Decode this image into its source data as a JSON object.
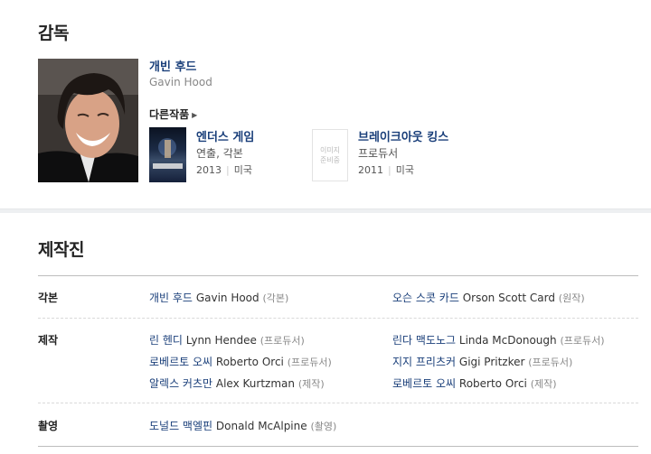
{
  "director": {
    "section_title": "감독",
    "name_ko": "개빈 후드",
    "name_en": "Gavin Hood",
    "other_works_label": "다른작품",
    "films": [
      {
        "title": "엔더스 게임",
        "role": "연출, 각본",
        "year": "2013",
        "country": "미국",
        "poster_title": "엔더스 게임"
      },
      {
        "title": "브레이크아웃 킹스",
        "role": "프로듀서",
        "year": "2011",
        "country": "미국",
        "placeholder": "이미지 준비중"
      }
    ]
  },
  "crew": {
    "section_title": "제작진",
    "rows": [
      {
        "label": "각본",
        "credits": [
          {
            "ko": "개빈 후드",
            "en": "Gavin Hood",
            "role": "(각본)"
          },
          {
            "ko": "오슨 스콧 카드",
            "en": "Orson Scott Card",
            "role": "(원작)"
          }
        ]
      },
      {
        "label": "제작",
        "credits": [
          {
            "ko": "린 헨디",
            "en": "Lynn Hendee",
            "role": "(프로듀서)"
          },
          {
            "ko": "린다 맥도노그",
            "en": "Linda McDonough",
            "role": "(프로듀서)"
          },
          {
            "ko": "로베르토 오씨",
            "en": "Roberto Orci",
            "role": "(프로듀서)"
          },
          {
            "ko": "지지 프리츠커",
            "en": "Gigi Pritzker",
            "role": "(프로듀서)"
          },
          {
            "ko": "알렉스 커츠만",
            "en": "Alex Kurtzman",
            "role": "(제작)"
          },
          {
            "ko": "로베르토 오씨",
            "en": "Roberto Orci",
            "role": "(제작)"
          }
        ]
      },
      {
        "label": "촬영",
        "credits": [
          {
            "ko": "도널드 맥엘핀",
            "en": "Donald McAlpine",
            "role": "(촬영)"
          }
        ]
      }
    ]
  }
}
